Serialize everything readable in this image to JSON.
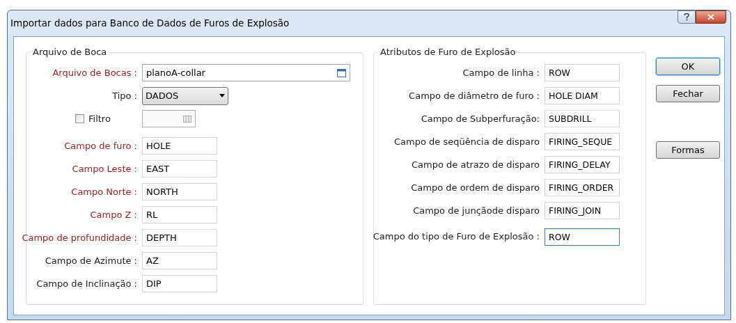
{
  "window": {
    "title": "Importar dados para Banco de Dados de Furos de Explosão"
  },
  "collar_group": {
    "title": "Arquivo de Boca",
    "file": {
      "label": "Arquivo de Bocas :",
      "value": "planoA-collar",
      "required": true
    },
    "type": {
      "label": "Tipo :",
      "value": "DADOS"
    },
    "filter": {
      "label": "Filtro",
      "checked": false
    },
    "fields": [
      {
        "label": "Campo de furo :",
        "value": "HOLE",
        "required": true
      },
      {
        "label": "Campo Leste :",
        "value": "EAST",
        "required": true
      },
      {
        "label": "Campo Norte :",
        "value": "NORTH",
        "required": true
      },
      {
        "label": "Campo Z :",
        "value": "RL",
        "required": true
      },
      {
        "label": "Campo de profundidade :",
        "value": "DEPTH",
        "required": true
      },
      {
        "label": "Campo de Azimute :",
        "value": "AZ",
        "required": false
      },
      {
        "label": "Campo de Inclinação :",
        "value": "DIP",
        "required": false
      }
    ]
  },
  "attributes_group": {
    "title": "Atributos de Furo de Explosão",
    "fields": [
      {
        "label": "Campo de linha :",
        "value": "ROW",
        "focused": false
      },
      {
        "label": "Campo de diâmetro de furo :",
        "value": "HOLE DIAM",
        "focused": false
      },
      {
        "label": "Campo de Subperfuração:",
        "value": "SUBDRILL",
        "focused": false
      },
      {
        "label": "Campo de seqüência de disparo",
        "value": "FIRING_SEQUE",
        "focused": false
      },
      {
        "label": "Campo de atrazo de disparo",
        "value": "FIRING_DELAY",
        "focused": false
      },
      {
        "label": "Campo de ordem de disparo",
        "value": "FIRING_ORDER",
        "focused": false
      },
      {
        "label": "Campo de junçãode disparo",
        "value": "FIRING_JOIN",
        "focused": false
      },
      {
        "label": "Campo do tipo de Furo de Explosão :",
        "value": "ROW",
        "focused": true
      }
    ]
  },
  "buttons": [
    {
      "label": "OK",
      "default": true
    },
    {
      "label": "Fechar",
      "default": false
    },
    {
      "label": "Formas",
      "default": false
    }
  ]
}
